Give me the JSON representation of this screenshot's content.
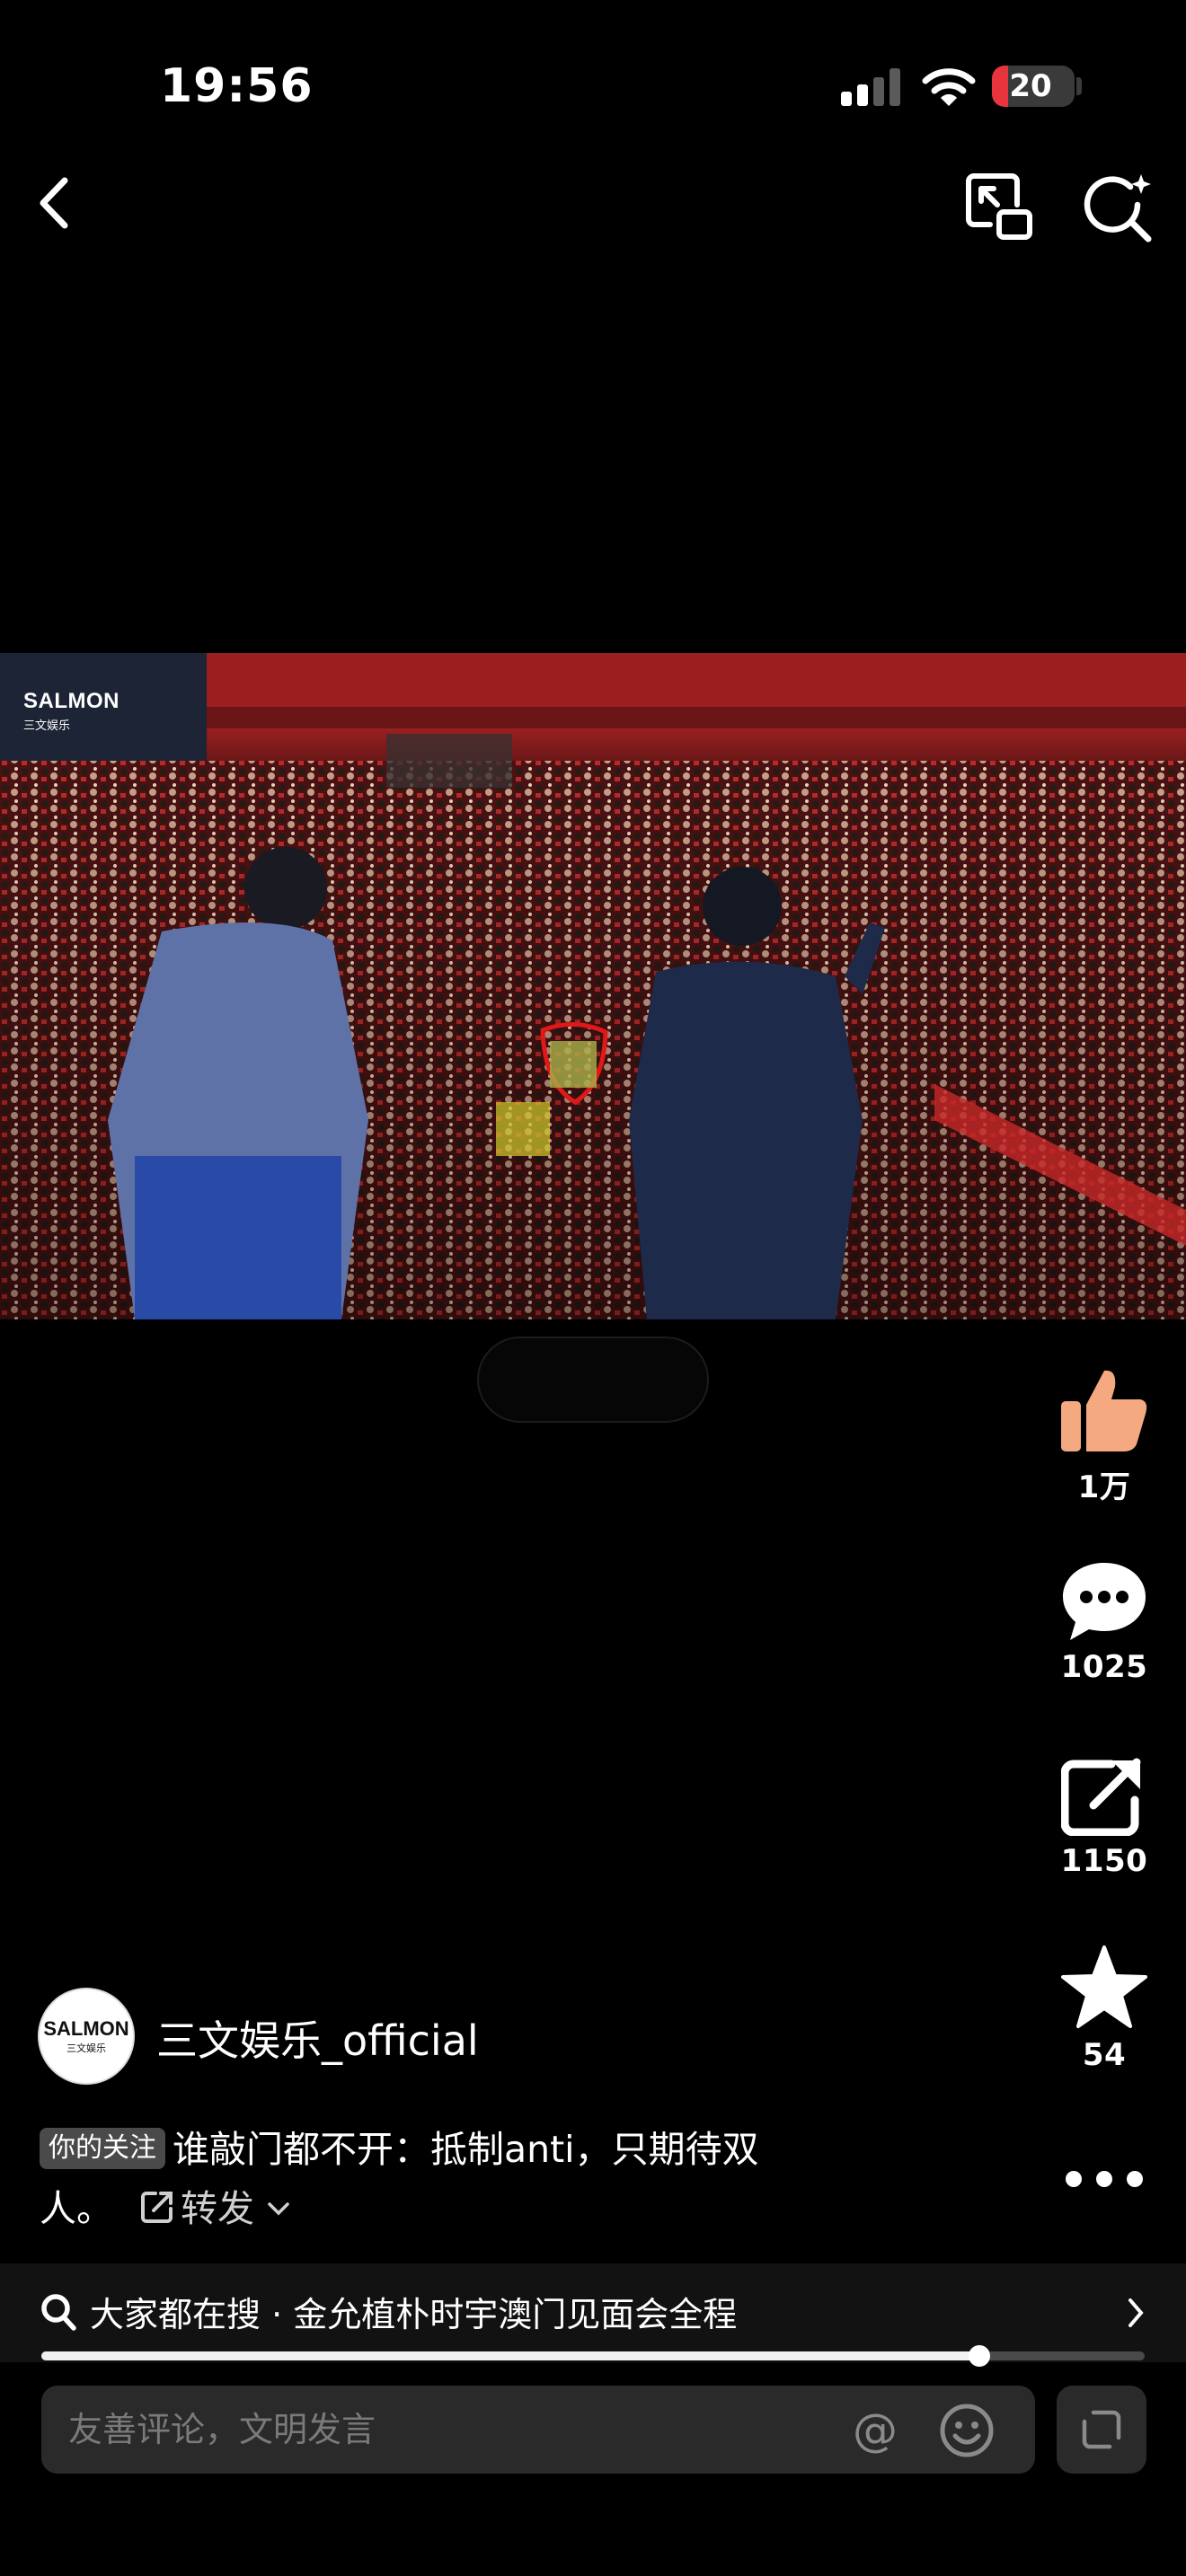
{
  "status_bar": {
    "time": "19:56",
    "battery_level": "20",
    "battery_fraction": 0.2,
    "battery_color": "#e8343c"
  },
  "top_bar": {
    "back_icon": "chevron-left-icon",
    "pip_icon": "picture-in-picture-icon",
    "search_icon": "search-sparkle-icon"
  },
  "video": {
    "watermark_title": "SALMON",
    "watermark_subtitle": "三文娱乐"
  },
  "actions": {
    "like_count": "1万",
    "comment_count": "1025",
    "share_count": "1150",
    "favorite_count": "54",
    "like_color": "#f4a980"
  },
  "author": {
    "name": "三文娱乐_official",
    "avatar_title": "SALMON",
    "avatar_subtitle": "三文娱乐"
  },
  "caption": {
    "tag": "你的关注",
    "text_line1": "谁敲门都不开：抵制anti，只期待双",
    "text_line2": "人。",
    "repost_label": "转发"
  },
  "search_suggestion": {
    "prefix": "大家都在搜",
    "separator": "·",
    "query": "金允植朴时宇澳门见面会全程"
  },
  "playback": {
    "progress_fraction": 0.85
  },
  "comment": {
    "placeholder": "友善评论，文明发言",
    "at_symbol": "@"
  }
}
